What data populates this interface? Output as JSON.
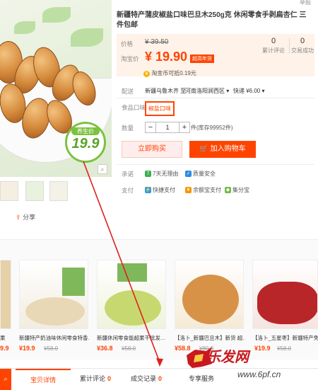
{
  "product": {
    "title": "新疆特产蒲皮椒盐口味巴旦木250g克 休闲零食手剥扁杏仁 三件包邮",
    "badge_label": "养生价",
    "badge_price": "19.9",
    "top_right_link": "举报"
  },
  "price": {
    "label": "价格",
    "original": "¥ 39.50",
    "promo_label": "淘宝价",
    "promo": "¥ 19.90",
    "promo_tag": "超高年货",
    "coin_text": "淘金币可抵0.19元"
  },
  "stats": [
    {
      "value": "0",
      "label": "累计评论"
    },
    {
      "value": "0",
      "label": "交易成功"
    }
  ],
  "delivery": {
    "label": "配送",
    "from": "新疆乌鲁木齐 至",
    "to": "河南洛阳涧西区 ▾",
    "shipping": "快递 ¥6.00 ▾"
  },
  "flavor": {
    "label": "食品口味",
    "option": "椒盐口味"
  },
  "quantity": {
    "label": "数量",
    "value": "1",
    "minus": "−",
    "plus": "+",
    "stock": "件(库存99952件)"
  },
  "actions": {
    "buy": "立即购买",
    "cart": "加入购物车"
  },
  "promise": {
    "label": "承诺",
    "items": [
      "7天无理由",
      "质量安全"
    ]
  },
  "payment": {
    "label": "支付",
    "items": [
      "快捷支付",
      "余额宝支付",
      "集分宝"
    ]
  },
  "share": "分享",
  "recommend": [
    {
      "name": "新疆特产奶油味休闲零食特香…",
      "price": "¥19.9",
      "orig": "¥58.0"
    },
    {
      "name": "新疆休闲零食能超果干批发…",
      "price": "¥36.8",
      "orig": "¥58.0"
    },
    {
      "name": "【洛卜_新疆巴旦木】新货 超…",
      "price": "¥58.8",
      "orig": "¥80.0"
    },
    {
      "name": "【洛卜_五星枣】新疆特产免…",
      "price": "¥19.9",
      "orig": "¥58.0"
    }
  ],
  "left_edge_card": {
    "price": "9.9",
    "name": "果"
  },
  "tabs": [
    {
      "label": "宝贝详情",
      "count": ""
    },
    {
      "label": "累计评论",
      "count": "0"
    },
    {
      "label": "成交记录",
      "count": "0"
    },
    {
      "label": "专享服务",
      "count": ""
    }
  ],
  "watermark": {
    "text": "乐发网",
    "url": "www.6pf.cn"
  },
  "colors": {
    "accent": "#ff4400",
    "badge": "#7cc242"
  }
}
